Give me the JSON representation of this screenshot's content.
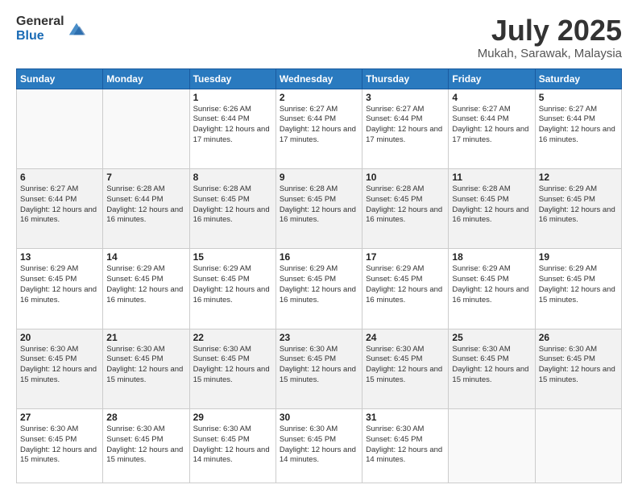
{
  "logo": {
    "general": "General",
    "blue": "Blue"
  },
  "title": {
    "month_year": "July 2025",
    "location": "Mukah, Sarawak, Malaysia"
  },
  "days_of_week": [
    "Sunday",
    "Monday",
    "Tuesday",
    "Wednesday",
    "Thursday",
    "Friday",
    "Saturday"
  ],
  "weeks": [
    [
      {
        "day": "",
        "sunrise": "",
        "sunset": "",
        "daylight": ""
      },
      {
        "day": "",
        "sunrise": "",
        "sunset": "",
        "daylight": ""
      },
      {
        "day": "1",
        "sunrise": "Sunrise: 6:26 AM",
        "sunset": "Sunset: 6:44 PM",
        "daylight": "Daylight: 12 hours and 17 minutes."
      },
      {
        "day": "2",
        "sunrise": "Sunrise: 6:27 AM",
        "sunset": "Sunset: 6:44 PM",
        "daylight": "Daylight: 12 hours and 17 minutes."
      },
      {
        "day": "3",
        "sunrise": "Sunrise: 6:27 AM",
        "sunset": "Sunset: 6:44 PM",
        "daylight": "Daylight: 12 hours and 17 minutes."
      },
      {
        "day": "4",
        "sunrise": "Sunrise: 6:27 AM",
        "sunset": "Sunset: 6:44 PM",
        "daylight": "Daylight: 12 hours and 17 minutes."
      },
      {
        "day": "5",
        "sunrise": "Sunrise: 6:27 AM",
        "sunset": "Sunset: 6:44 PM",
        "daylight": "Daylight: 12 hours and 16 minutes."
      }
    ],
    [
      {
        "day": "6",
        "sunrise": "Sunrise: 6:27 AM",
        "sunset": "Sunset: 6:44 PM",
        "daylight": "Daylight: 12 hours and 16 minutes."
      },
      {
        "day": "7",
        "sunrise": "Sunrise: 6:28 AM",
        "sunset": "Sunset: 6:44 PM",
        "daylight": "Daylight: 12 hours and 16 minutes."
      },
      {
        "day": "8",
        "sunrise": "Sunrise: 6:28 AM",
        "sunset": "Sunset: 6:45 PM",
        "daylight": "Daylight: 12 hours and 16 minutes."
      },
      {
        "day": "9",
        "sunrise": "Sunrise: 6:28 AM",
        "sunset": "Sunset: 6:45 PM",
        "daylight": "Daylight: 12 hours and 16 minutes."
      },
      {
        "day": "10",
        "sunrise": "Sunrise: 6:28 AM",
        "sunset": "Sunset: 6:45 PM",
        "daylight": "Daylight: 12 hours and 16 minutes."
      },
      {
        "day": "11",
        "sunrise": "Sunrise: 6:28 AM",
        "sunset": "Sunset: 6:45 PM",
        "daylight": "Daylight: 12 hours and 16 minutes."
      },
      {
        "day": "12",
        "sunrise": "Sunrise: 6:29 AM",
        "sunset": "Sunset: 6:45 PM",
        "daylight": "Daylight: 12 hours and 16 minutes."
      }
    ],
    [
      {
        "day": "13",
        "sunrise": "Sunrise: 6:29 AM",
        "sunset": "Sunset: 6:45 PM",
        "daylight": "Daylight: 12 hours and 16 minutes."
      },
      {
        "day": "14",
        "sunrise": "Sunrise: 6:29 AM",
        "sunset": "Sunset: 6:45 PM",
        "daylight": "Daylight: 12 hours and 16 minutes."
      },
      {
        "day": "15",
        "sunrise": "Sunrise: 6:29 AM",
        "sunset": "Sunset: 6:45 PM",
        "daylight": "Daylight: 12 hours and 16 minutes."
      },
      {
        "day": "16",
        "sunrise": "Sunrise: 6:29 AM",
        "sunset": "Sunset: 6:45 PM",
        "daylight": "Daylight: 12 hours and 16 minutes."
      },
      {
        "day": "17",
        "sunrise": "Sunrise: 6:29 AM",
        "sunset": "Sunset: 6:45 PM",
        "daylight": "Daylight: 12 hours and 16 minutes."
      },
      {
        "day": "18",
        "sunrise": "Sunrise: 6:29 AM",
        "sunset": "Sunset: 6:45 PM",
        "daylight": "Daylight: 12 hours and 16 minutes."
      },
      {
        "day": "19",
        "sunrise": "Sunrise: 6:29 AM",
        "sunset": "Sunset: 6:45 PM",
        "daylight": "Daylight: 12 hours and 15 minutes."
      }
    ],
    [
      {
        "day": "20",
        "sunrise": "Sunrise: 6:30 AM",
        "sunset": "Sunset: 6:45 PM",
        "daylight": "Daylight: 12 hours and 15 minutes."
      },
      {
        "day": "21",
        "sunrise": "Sunrise: 6:30 AM",
        "sunset": "Sunset: 6:45 PM",
        "daylight": "Daylight: 12 hours and 15 minutes."
      },
      {
        "day": "22",
        "sunrise": "Sunrise: 6:30 AM",
        "sunset": "Sunset: 6:45 PM",
        "daylight": "Daylight: 12 hours and 15 minutes."
      },
      {
        "day": "23",
        "sunrise": "Sunrise: 6:30 AM",
        "sunset": "Sunset: 6:45 PM",
        "daylight": "Daylight: 12 hours and 15 minutes."
      },
      {
        "day": "24",
        "sunrise": "Sunrise: 6:30 AM",
        "sunset": "Sunset: 6:45 PM",
        "daylight": "Daylight: 12 hours and 15 minutes."
      },
      {
        "day": "25",
        "sunrise": "Sunrise: 6:30 AM",
        "sunset": "Sunset: 6:45 PM",
        "daylight": "Daylight: 12 hours and 15 minutes."
      },
      {
        "day": "26",
        "sunrise": "Sunrise: 6:30 AM",
        "sunset": "Sunset: 6:45 PM",
        "daylight": "Daylight: 12 hours and 15 minutes."
      }
    ],
    [
      {
        "day": "27",
        "sunrise": "Sunrise: 6:30 AM",
        "sunset": "Sunset: 6:45 PM",
        "daylight": "Daylight: 12 hours and 15 minutes."
      },
      {
        "day": "28",
        "sunrise": "Sunrise: 6:30 AM",
        "sunset": "Sunset: 6:45 PM",
        "daylight": "Daylight: 12 hours and 15 minutes."
      },
      {
        "day": "29",
        "sunrise": "Sunrise: 6:30 AM",
        "sunset": "Sunset: 6:45 PM",
        "daylight": "Daylight: 12 hours and 14 minutes."
      },
      {
        "day": "30",
        "sunrise": "Sunrise: 6:30 AM",
        "sunset": "Sunset: 6:45 PM",
        "daylight": "Daylight: 12 hours and 14 minutes."
      },
      {
        "day": "31",
        "sunrise": "Sunrise: 6:30 AM",
        "sunset": "Sunset: 6:45 PM",
        "daylight": "Daylight: 12 hours and 14 minutes."
      },
      {
        "day": "",
        "sunrise": "",
        "sunset": "",
        "daylight": ""
      },
      {
        "day": "",
        "sunrise": "",
        "sunset": "",
        "daylight": ""
      }
    ]
  ]
}
